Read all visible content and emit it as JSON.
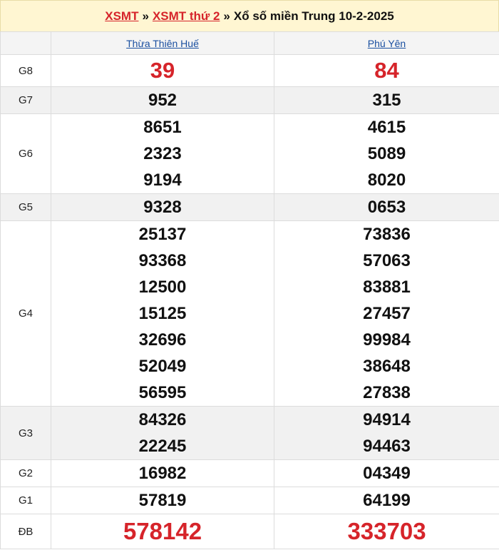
{
  "header": {
    "link1": "XSMT",
    "sep1": "»",
    "link2": "XSMT thứ 2",
    "sep2": "»",
    "title": "Xổ số miền Trung 10-2-2025"
  },
  "provinces": [
    "Thừa Thiên Huế",
    "Phú Yên"
  ],
  "prizes": [
    {
      "label": "G8",
      "style": "big",
      "grey": false,
      "values": [
        [
          "39"
        ],
        [
          "84"
        ]
      ]
    },
    {
      "label": "G7",
      "style": "num",
      "grey": true,
      "values": [
        [
          "952"
        ],
        [
          "315"
        ]
      ]
    },
    {
      "label": "G6",
      "style": "num",
      "grey": false,
      "values": [
        [
          "8651",
          "2323",
          "9194"
        ],
        [
          "4615",
          "5089",
          "8020"
        ]
      ]
    },
    {
      "label": "G5",
      "style": "num",
      "grey": true,
      "values": [
        [
          "9328"
        ],
        [
          "0653"
        ]
      ]
    },
    {
      "label": "G4",
      "style": "num",
      "grey": false,
      "values": [
        [
          "25137",
          "93368",
          "12500",
          "15125",
          "32696",
          "52049",
          "56595"
        ],
        [
          "73836",
          "57063",
          "83881",
          "27457",
          "99984",
          "38648",
          "27838"
        ]
      ]
    },
    {
      "label": "G3",
      "style": "num",
      "grey": true,
      "values": [
        [
          "84326",
          "22245"
        ],
        [
          "94914",
          "94463"
        ]
      ]
    },
    {
      "label": "G2",
      "style": "num",
      "grey": false,
      "values": [
        [
          "16982"
        ],
        [
          "04349"
        ]
      ]
    },
    {
      "label": "G1",
      "style": "num",
      "grey": false,
      "values": [
        [
          "57819"
        ],
        [
          "64199"
        ]
      ]
    },
    {
      "label": "ĐB",
      "style": "jack",
      "grey": false,
      "values": [
        [
          "578142"
        ],
        [
          "333703"
        ]
      ]
    }
  ]
}
